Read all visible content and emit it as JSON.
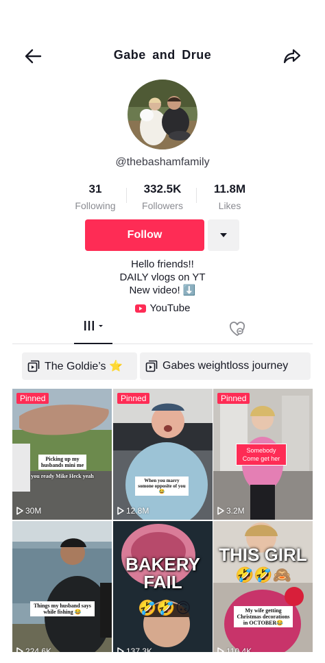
{
  "header": {
    "title": "Gabe  and  Drue"
  },
  "profile": {
    "handle": "@thebashamfamily"
  },
  "stats": [
    {
      "num": "31",
      "label": "Following"
    },
    {
      "num": "332.5K",
      "label": "Followers"
    },
    {
      "num": "11.8M",
      "label": "Likes"
    }
  ],
  "actions": {
    "follow": "Follow"
  },
  "bio": {
    "line1": "Hello friends!!",
    "line2": "DAILY vlogs on YT",
    "line3": "New video! ⬇️"
  },
  "link": {
    "label": "YouTube"
  },
  "playlists": [
    {
      "label": "The Goldie’s ⭐"
    },
    {
      "label": "Gabes weightloss journey"
    }
  ],
  "videos": [
    {
      "pinned": "Pinned",
      "views": "30M",
      "caption": "Picking up my husbands mini me",
      "caption2": "you ready Mike Heck yeah"
    },
    {
      "pinned": "Pinned",
      "views": "12.8M",
      "caption": "When you marry somone opposite of you😂"
    },
    {
      "pinned": "Pinned",
      "views": "3.2M",
      "caption": "Somebody Come get her"
    },
    {
      "views": "224.6K",
      "caption": "Things my husband says while fishing 😂"
    },
    {
      "views": "137.3K",
      "caption_big": "BAKERY FAIL",
      "emoji": "🤣🤣🙃"
    },
    {
      "views": "110.4K",
      "caption_big": "THIS GIRL",
      "emoji": "🤣🤣🙈",
      "caption": "My wife getting Christmas decorations in OCTOBER😂"
    }
  ],
  "colors": {
    "accent": "#fe2c55",
    "text": "#161823",
    "muted": "#8a8b91",
    "chip": "#f1f1f2"
  },
  "icons": [
    "back-arrow-icon",
    "share-icon",
    "caret-down-icon",
    "youtube-icon",
    "grid-icon",
    "liked-icon",
    "playlist-icon",
    "play-icon"
  ]
}
